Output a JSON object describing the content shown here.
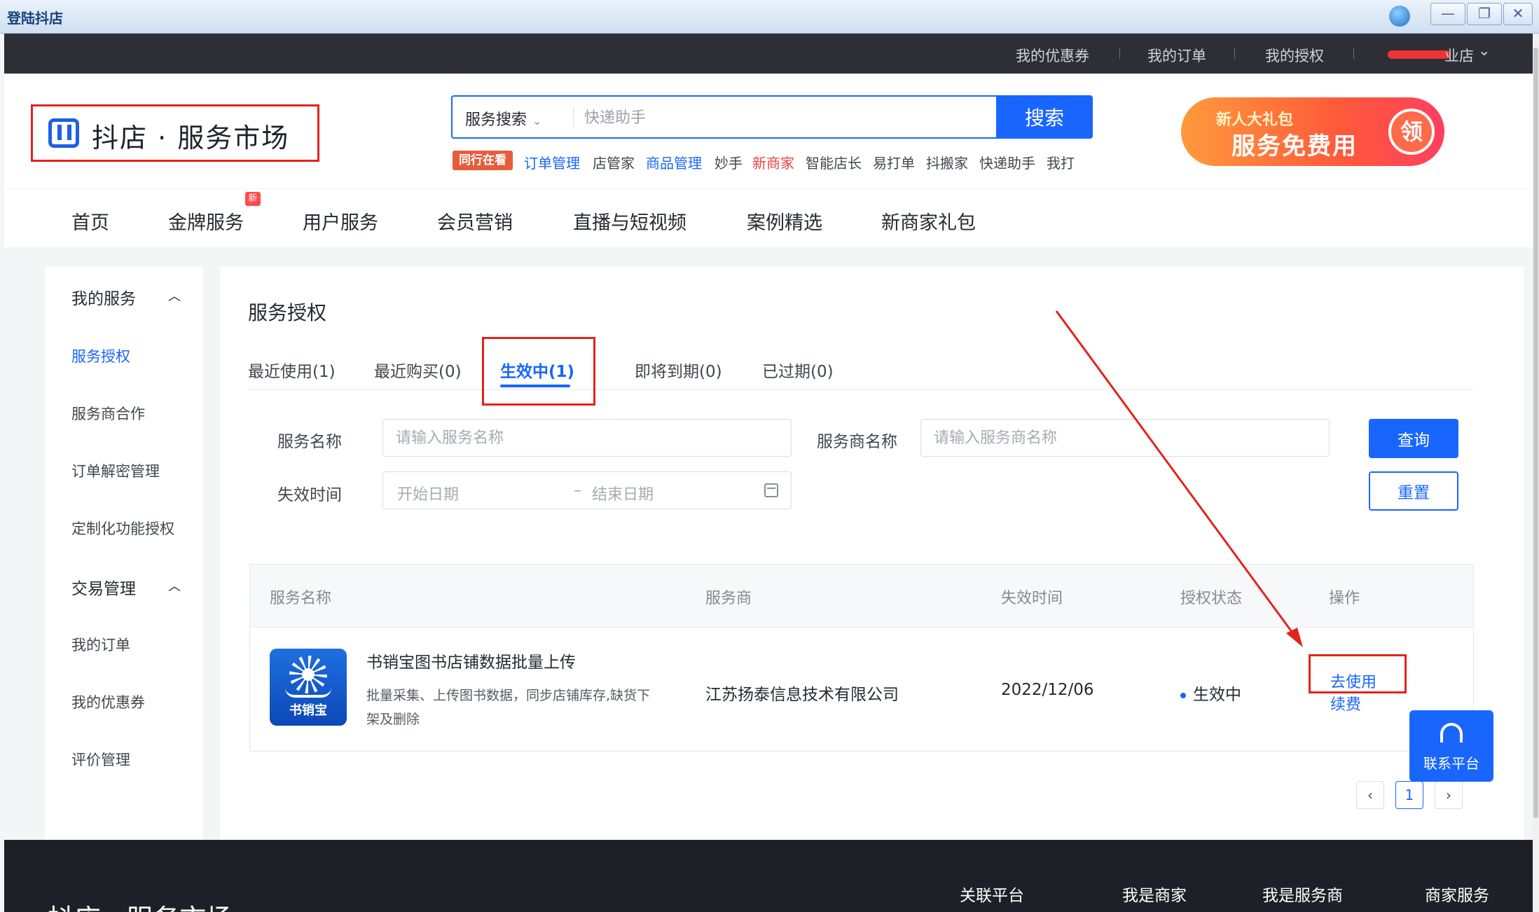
{
  "window": {
    "title": "登陆抖店",
    "controls": [
      "—",
      "❐",
      "✕"
    ]
  },
  "topbar": {
    "links": [
      "我的优惠券",
      "我的订单",
      "我的授权"
    ],
    "shop": "业店"
  },
  "header": {
    "logo": "抖店 · 服务市场",
    "search_type": "服务搜索",
    "search_placeholder": "快递助手",
    "search_button": "搜索",
    "hot_tag": "同行在看",
    "hot_items": [
      {
        "label": "订单管理",
        "color": "#1966ff"
      },
      {
        "label": "店管家",
        "color": "#41464f"
      },
      {
        "label": "商品管理",
        "color": "#1966ff"
      },
      {
        "label": "妙手",
        "color": "#41464f"
      },
      {
        "label": "新商家",
        "color": "#f04142"
      },
      {
        "label": "智能店长",
        "color": "#41464f"
      },
      {
        "label": "易打单",
        "color": "#41464f"
      },
      {
        "label": "抖搬家",
        "color": "#41464f"
      },
      {
        "label": "快递助手",
        "color": "#41464f"
      },
      {
        "label": "我打",
        "color": "#41464f"
      }
    ],
    "promo_small": "新人大礼包",
    "promo_big": "服务免费用",
    "promo_badge": "领"
  },
  "nav": {
    "items": [
      "首页",
      "金牌服务",
      "用户服务",
      "会员营销",
      "直播与短视频",
      "案例精选",
      "新商家礼包"
    ],
    "new_badge": "新"
  },
  "sidebar": {
    "group1": "我的服务",
    "group1_items": [
      "服务授权",
      "服务商合作",
      "订单解密管理",
      "定制化功能授权"
    ],
    "group2": "交易管理",
    "group2_items": [
      "我的订单",
      "我的优惠券",
      "评价管理"
    ]
  },
  "main": {
    "title": "服务授权",
    "tabs": [
      "最近使用(1)",
      "最近购买(0)",
      "生效中(1)",
      "即将到期(0)",
      "已过期(0)"
    ],
    "active_tab": "生效中(1)",
    "filters": {
      "service_name_label": "服务名称",
      "service_name_placeholder": "请输入服务名称",
      "provider_label": "服务商名称",
      "provider_placeholder": "请输入服务商名称",
      "expire_label": "失效时间",
      "start_placeholder": "开始日期",
      "range_sep": "–",
      "end_placeholder": "结束日期",
      "query_button": "查询",
      "reset_button": "重置"
    },
    "table": {
      "headers": [
        "服务名称",
        "服务商",
        "失效时间",
        "授权状态",
        "操作"
      ],
      "rows": [
        {
          "icon_text": "书销宝",
          "name": "书销宝图书店铺数据批量上传",
          "desc": "批量采集、上传图书数据，同步店铺库存,缺货下架及删除",
          "provider": "江苏扬泰信息技术有限公司",
          "expire": "2022/12/06",
          "status": "生效中",
          "actions": [
            "去使用",
            "续费"
          ]
        }
      ]
    },
    "pager": {
      "prev": "‹",
      "current": "1",
      "next": "›"
    }
  },
  "contact": {
    "label": "联系平台"
  },
  "footer": {
    "links": [
      "关联平台",
      "我是商家",
      "我是服务商",
      "商家服务"
    ],
    "logo": "抖店 · 服务市场"
  },
  "colors": {
    "accent": "#1966ff",
    "annotation": "#e1251b",
    "footer": "#1d2027",
    "topbar": "#2c2f36"
  }
}
